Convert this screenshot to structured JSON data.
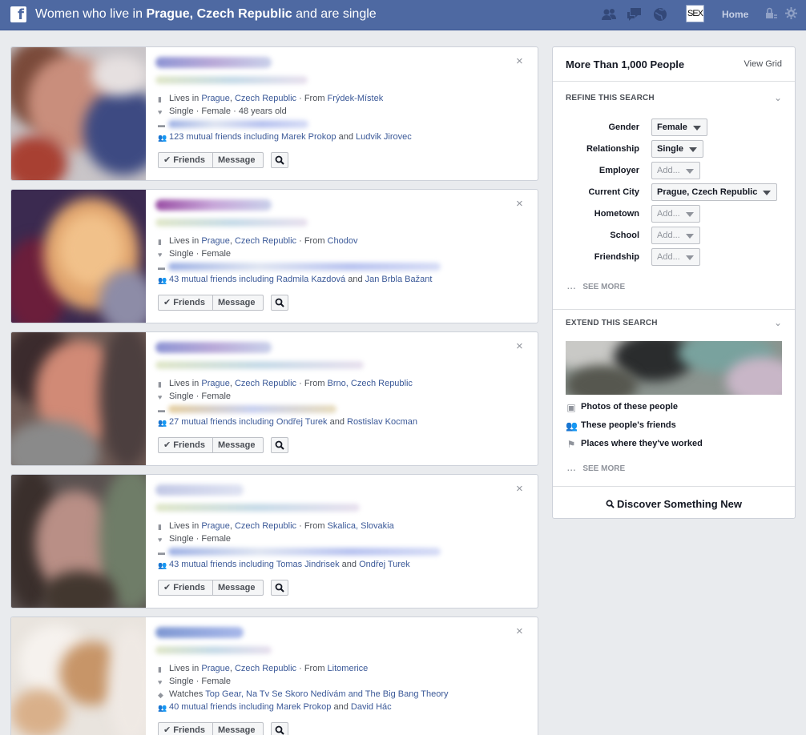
{
  "topbar": {
    "title_prefix": "Women who live in ",
    "title_city": "Prague, Czech Republic",
    "title_suffix": " and are single",
    "logo": "f",
    "profile_label": "SEX",
    "home_label": "Home",
    "icons": [
      "friends-icon",
      "messages-icon",
      "notifications-icon",
      "privacy-icon",
      "settings-icon"
    ]
  },
  "results": [
    {
      "lives_in_label": "Lives in",
      "city": "Prague",
      "country": "Czech Republic",
      "from_label": "From",
      "from": "Frýdek-Místek",
      "status": "Single",
      "gender": "Female",
      "age": "48 years old",
      "mutual_count": "123 mutual friends including",
      "mutual_a": "Marek Prokop",
      "mutual_and": "and",
      "mutual_b": "Ludvik Jirovec",
      "watches": ""
    },
    {
      "lives_in_label": "Lives in",
      "city": "Prague",
      "country": "Czech Republic",
      "from_label": "From",
      "from": "Chodov",
      "status": "Single",
      "gender": "Female",
      "age": "",
      "mutual_count": "43 mutual friends including",
      "mutual_a": "Radmila Kazdová",
      "mutual_and": "and",
      "mutual_b": "Jan Brbla Bažant",
      "watches": ""
    },
    {
      "lives_in_label": "Lives in",
      "city": "Prague",
      "country": "Czech Republic",
      "from_label": "From",
      "from": "Brno, Czech Republic",
      "status": "Single",
      "gender": "Female",
      "age": "",
      "mutual_count": "27 mutual friends including",
      "mutual_a": "Ondřej Turek",
      "mutual_and": "and",
      "mutual_b": "Rostislav Kocman",
      "watches": ""
    },
    {
      "lives_in_label": "Lives in",
      "city": "Prague",
      "country": "Czech Republic",
      "from_label": "From",
      "from": "Skalica, Slovakia",
      "status": "Single",
      "gender": "Female",
      "age": "",
      "mutual_count": "43 mutual friends including",
      "mutual_a": "Tomas Jindrisek",
      "mutual_and": "and",
      "mutual_b": "Ondřej Turek",
      "watches": ""
    },
    {
      "lives_in_label": "Lives in",
      "city": "Prague",
      "country": "Czech Republic",
      "from_label": "From",
      "from": "Litomerice",
      "status": "Single",
      "gender": "Female",
      "age": "",
      "mutual_count": "40 mutual friends including",
      "mutual_a": "Marek Prokop",
      "mutual_and": "and",
      "mutual_b": "David Hác",
      "watches_label": "Watches",
      "watches": "Top Gear, Na Tv Se Skoro Nedívám and The Big Bang Theory"
    }
  ],
  "buttons": {
    "friends": "Friends",
    "message": "Message",
    "close": "×",
    "dot": "·"
  },
  "sidebar": {
    "count": "More Than 1,000 People",
    "view_grid": "View Grid",
    "refine_title": "Refine This Search",
    "filters": [
      {
        "label": "Gender",
        "value": "Female",
        "empty": false
      },
      {
        "label": "Relationship",
        "value": "Single",
        "empty": false
      },
      {
        "label": "Employer",
        "value": "Add...",
        "empty": true
      },
      {
        "label": "Current City",
        "value": "Prague, Czech Republic",
        "empty": false
      },
      {
        "label": "Hometown",
        "value": "Add...",
        "empty": true
      },
      {
        "label": "School",
        "value": "Add...",
        "empty": true
      },
      {
        "label": "Friendship",
        "value": "Add...",
        "empty": true
      }
    ],
    "see_more": "See More",
    "see_more_dots": "...",
    "extend_title": "Extend This Search",
    "extend_items": [
      {
        "icon": "photos-icon",
        "label": "Photos of these people"
      },
      {
        "icon": "friends-icon",
        "label": "These people's friends"
      },
      {
        "icon": "flag-icon",
        "label": "Places where they've worked"
      }
    ],
    "discover": "Discover Something New"
  },
  "colors": {
    "topbar": "#4e69a2",
    "link": "#3b5998",
    "page_bg": "#e9ebee"
  }
}
